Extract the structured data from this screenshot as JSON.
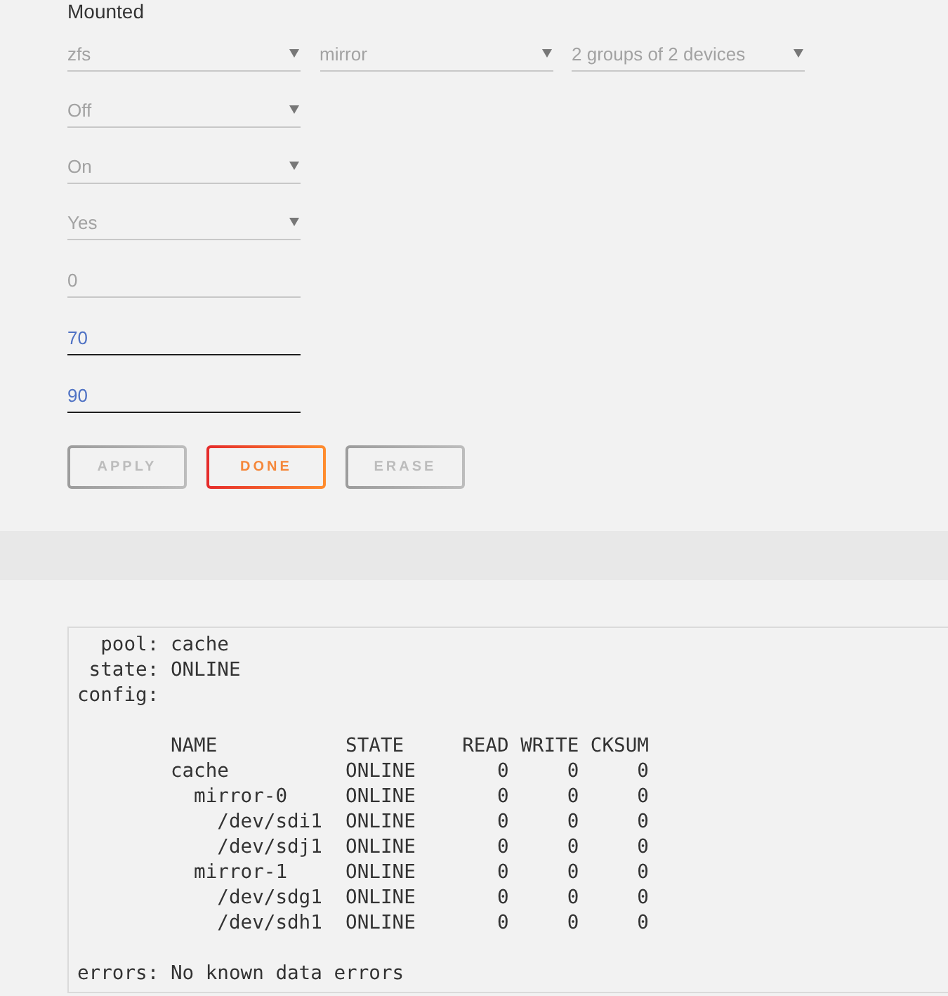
{
  "section_title": "Mounted",
  "form": {
    "rows": [
      {
        "fields": [
          {
            "kind": "select",
            "value": "zfs",
            "disabled": true
          },
          {
            "kind": "select",
            "value": "mirror",
            "disabled": true
          },
          {
            "kind": "select",
            "value": "2 groups of 2 devices",
            "disabled": true
          }
        ]
      },
      {
        "fields": [
          {
            "kind": "select",
            "value": "Off",
            "disabled": true
          }
        ]
      },
      {
        "fields": [
          {
            "kind": "select",
            "value": "On",
            "disabled": true
          }
        ]
      },
      {
        "fields": [
          {
            "kind": "select",
            "value": "Yes",
            "disabled": true
          }
        ]
      },
      {
        "fields": [
          {
            "kind": "input",
            "value": "0",
            "disabled": true
          }
        ]
      },
      {
        "fields": [
          {
            "kind": "input",
            "value": "70",
            "disabled": false
          }
        ]
      },
      {
        "fields": [
          {
            "kind": "input",
            "value": "90",
            "disabled": false
          }
        ]
      }
    ]
  },
  "buttons": [
    {
      "label": "APPLY",
      "disabled": true
    },
    {
      "label": "DONE",
      "disabled": false
    },
    {
      "label": "ERASE",
      "disabled": true
    }
  ],
  "status_output": {
    "fields": [
      {
        "label": "pool:",
        "value": "cache"
      },
      {
        "label": "state:",
        "value": "ONLINE"
      },
      {
        "label": "config:"
      }
    ],
    "config": {
      "columns": [
        "NAME",
        "STATE",
        "READ",
        "WRITE",
        "CKSUM"
      ],
      "rows": [
        {
          "name": "cache",
          "state": "ONLINE",
          "read": "0",
          "write": "0",
          "cksum": "0",
          "children": [
            {
              "name": "mirror-0",
              "state": "ONLINE",
              "read": "0",
              "write": "0",
              "cksum": "0",
              "children": [
                {
                  "name": "/dev/sdi1",
                  "state": "ONLINE",
                  "read": "0",
                  "write": "0",
                  "cksum": "0"
                },
                {
                  "name": "/dev/sdj1",
                  "state": "ONLINE",
                  "read": "0",
                  "write": "0",
                  "cksum": "0"
                }
              ]
            },
            {
              "name": "mirror-1",
              "state": "ONLINE",
              "read": "0",
              "write": "0",
              "cksum": "0",
              "children": [
                {
                  "name": "/dev/sdg1",
                  "state": "ONLINE",
                  "read": "0",
                  "write": "0",
                  "cksum": "0"
                },
                {
                  "name": "/dev/sdh1",
                  "state": "ONLINE",
                  "read": "0",
                  "write": "0",
                  "cksum": "0"
                }
              ]
            }
          ]
        }
      ]
    },
    "errors": {
      "label": "errors:",
      "value": "No known data errors"
    }
  }
}
